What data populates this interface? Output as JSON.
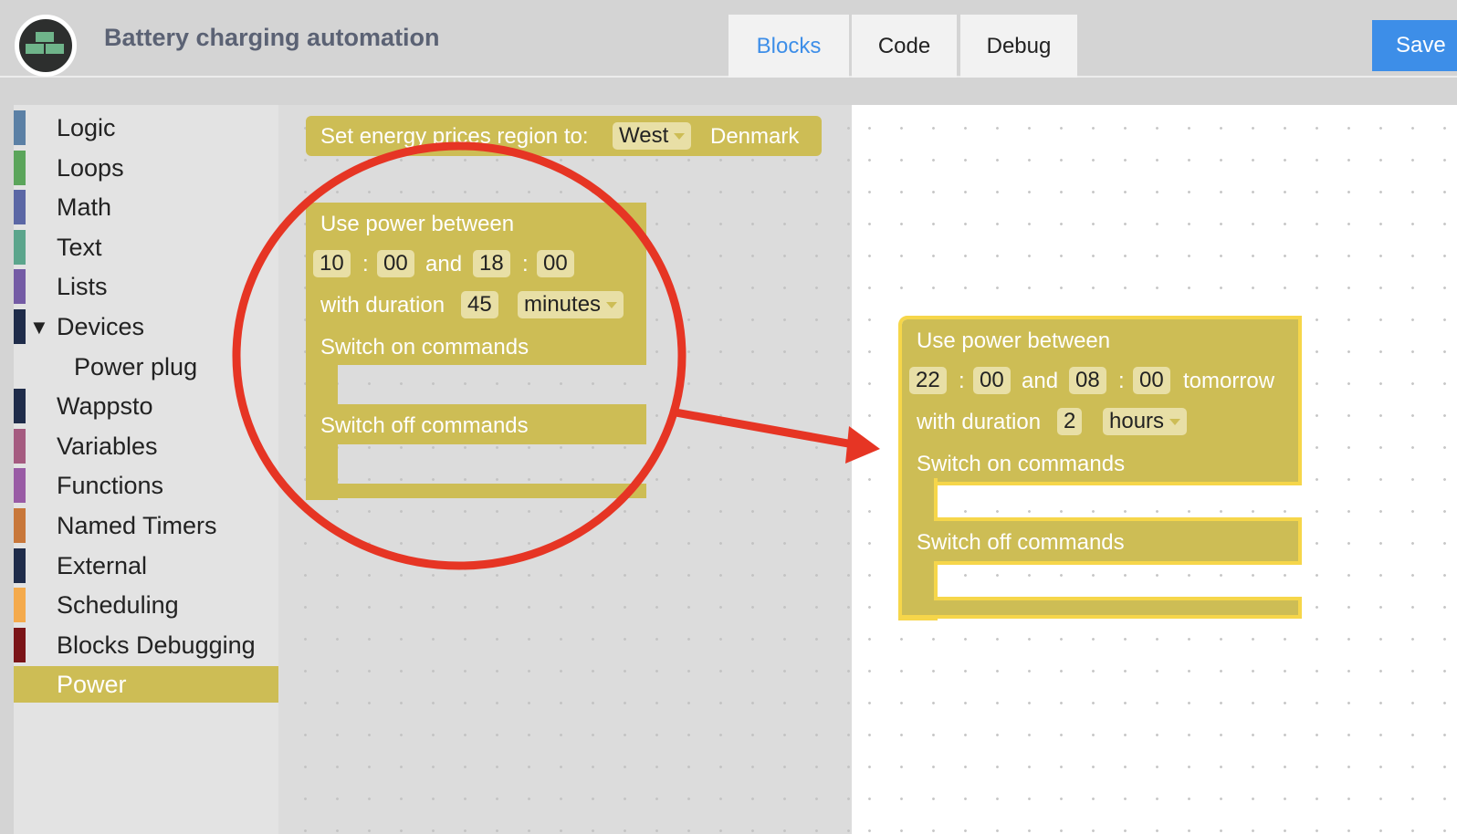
{
  "header": {
    "title": "Battery charging automation",
    "tabs": [
      {
        "label": "Blocks",
        "active": true
      },
      {
        "label": "Code"
      },
      {
        "label": "Debug"
      }
    ],
    "save_label": "Save"
  },
  "sidebar": {
    "items": [
      {
        "label": "Logic",
        "color": "#5b80a5"
      },
      {
        "label": "Loops",
        "color": "#5ba55b"
      },
      {
        "label": "Math",
        "color": "#5b67a5"
      },
      {
        "label": "Text",
        "color": "#5ba58c"
      },
      {
        "label": "Lists",
        "color": "#745ba5"
      },
      {
        "label": "Devices",
        "color": "#1f2c4a",
        "expanded": true
      },
      {
        "label": "Power plug"
      },
      {
        "label": "Wappsto",
        "color": "#1f2c4a"
      },
      {
        "label": "Variables",
        "color": "#a55b80"
      },
      {
        "label": "Functions",
        "color": "#995ba5"
      },
      {
        "label": "Named Timers",
        "color": "#c8773a"
      },
      {
        "label": "External",
        "color": "#1f2c4a"
      },
      {
        "label": "Scheduling",
        "color": "#f4aa4c"
      },
      {
        "label": "Blocks Debugging",
        "color": "#7b1418"
      },
      {
        "label": "Power",
        "color": "#cdbd55",
        "selected": true
      }
    ]
  },
  "flyout": {
    "region_block": {
      "label": "Set energy prices region to:",
      "region": "West",
      "suffix": "Denmark"
    },
    "power_block": {
      "title": "Use power between",
      "start_h": "10",
      "start_m": "00",
      "and": "and",
      "end_h": "18",
      "end_m": "00",
      "sep": ":",
      "duration_label": "with duration",
      "duration": "45",
      "unit": "minutes",
      "on_label": "Switch on commands",
      "off_label": "Switch off commands"
    }
  },
  "workspace": {
    "power_block": {
      "title": "Use power between",
      "start_h": "22",
      "start_m": "00",
      "and": "and",
      "end_h": "08",
      "end_m": "00",
      "sep": ":",
      "tomorrow": "tomorrow",
      "duration_label": "with duration",
      "duration": "2",
      "unit": "hours",
      "on_label": "Switch on commands",
      "off_label": "Switch off commands"
    }
  },
  "annotation": {
    "color": "#e63524"
  }
}
